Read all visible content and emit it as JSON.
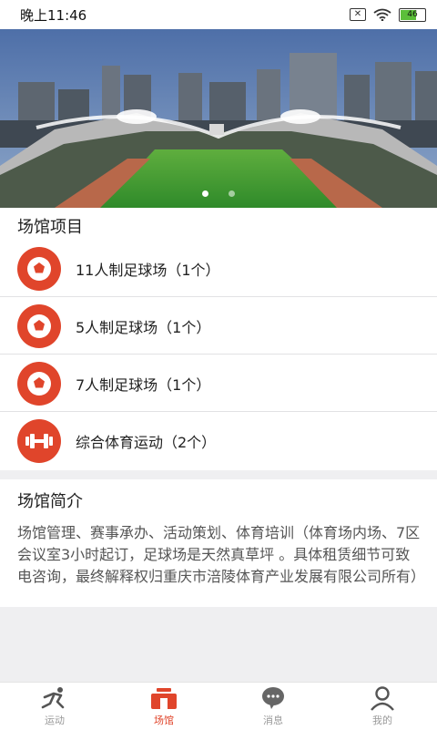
{
  "status_bar": {
    "time": "晚上11:46",
    "battery_level": "46",
    "icons": [
      "sim-off-icon",
      "wifi-icon",
      "battery-icon"
    ]
  },
  "banner": {
    "slide_count": 2,
    "active_slide": 0
  },
  "venue_items": {
    "title": "场馆项目",
    "items": [
      {
        "label": "11人制足球场（1个）",
        "icon": "football-icon"
      },
      {
        "label": "5人制足球场（1个）",
        "icon": "football-icon"
      },
      {
        "label": "7人制足球场（1个）",
        "icon": "football-icon"
      },
      {
        "label": "综合体育运动（2个）",
        "icon": "dumbbell-icon"
      }
    ]
  },
  "venue_intro": {
    "title": "场馆简介",
    "text": "场馆管理、赛事承办、活动策划、体育培训（体育场内场、7区会议室3小时起订，足球场是天然真草坪 。具体租赁细节可致电咨询，最终解释权归重庆市涪陵体育产业发展有限公司所有）"
  },
  "tab_bar": {
    "tabs": [
      {
        "label": "运动",
        "icon": "runner-icon",
        "active": false
      },
      {
        "label": "场馆",
        "icon": "venue-icon",
        "active": true
      },
      {
        "label": "消息",
        "icon": "chat-bubble-icon",
        "active": false
      },
      {
        "label": "我的",
        "icon": "person-icon",
        "active": false
      }
    ]
  },
  "colors": {
    "accent": "#e0452b",
    "background": "#efeff1",
    "inactive_tab": "#999999"
  }
}
